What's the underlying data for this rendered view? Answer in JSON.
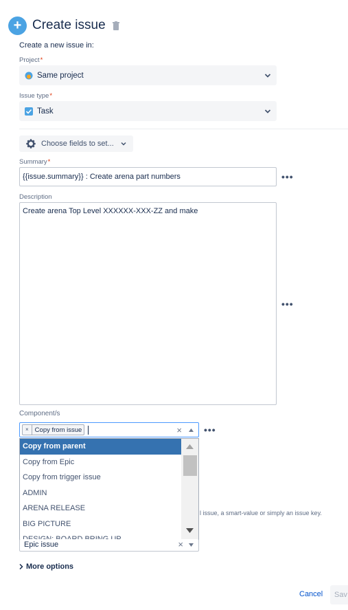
{
  "header": {
    "title": "Create issue"
  },
  "create_in_label": "Create a new issue in:",
  "project": {
    "label": "Project",
    "required": "*",
    "value": "Same project"
  },
  "issue_type": {
    "label": "Issue type",
    "required": "*",
    "value": "Task"
  },
  "choose_fields": {
    "label": "Choose fields to set..."
  },
  "summary": {
    "label": "Summary",
    "required": "*",
    "value": "{{issue.summary}} : Create arena part numbers"
  },
  "description": {
    "label": "Description",
    "value": "Create arena Top Level XXXXXX-XXX-ZZ and make"
  },
  "components": {
    "label": "Component/s",
    "tag": "Copy from issue",
    "options": [
      "Copy from parent",
      "Copy from Epic",
      "Copy from trigger issue",
      "ADMIN",
      "ARENA RELEASE",
      "BIG PICTURE",
      "DESIGN: BOARD BRING UP"
    ]
  },
  "hint_text": "l issue, a smart-value or simply an issue key.",
  "epic": {
    "value": "Epic issue"
  },
  "more_options": {
    "label": "More options"
  },
  "footer": {
    "cancel": "Cancel",
    "save": "Sav"
  },
  "more_glyph": "•••",
  "clear_glyph": "×",
  "colors": {
    "accent": "#4ba3e3",
    "link": "#0052cc",
    "selected_option": "#3572b0"
  }
}
